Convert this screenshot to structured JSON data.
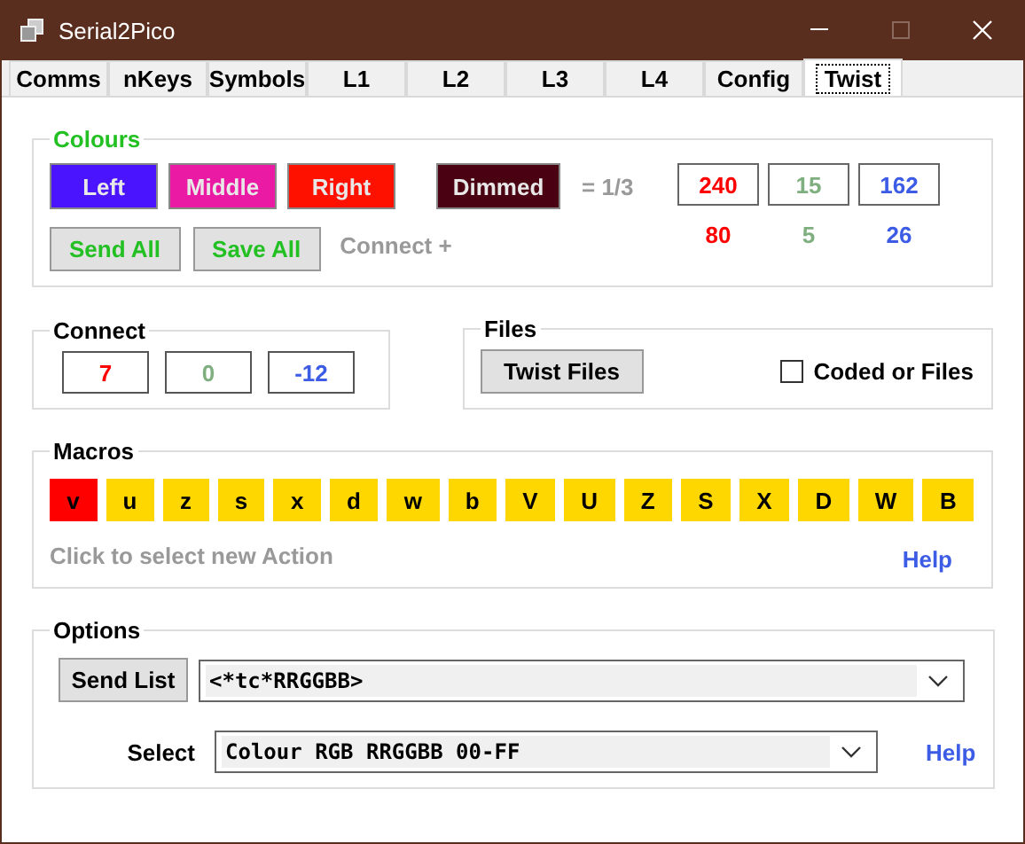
{
  "window": {
    "title": "Serial2Pico"
  },
  "tabs": [
    {
      "label": "Comms",
      "selected": false
    },
    {
      "label": "nKeys",
      "selected": false
    },
    {
      "label": "Symbols",
      "selected": false
    },
    {
      "label": "L1",
      "selected": false
    },
    {
      "label": "L2",
      "selected": false
    },
    {
      "label": "L3",
      "selected": false
    },
    {
      "label": "L4",
      "selected": false
    },
    {
      "label": "Config",
      "selected": false
    },
    {
      "label": "Twist",
      "selected": true
    }
  ],
  "colours": {
    "title": "Colours",
    "buttons": [
      {
        "label": "Left",
        "color": "#4b14ff"
      },
      {
        "label": "Middle",
        "color": "#ea1aa4"
      },
      {
        "label": "Right",
        "color": "#ff1100"
      }
    ],
    "dimmed": {
      "label": "Dimmed",
      "color": "#4a0212"
    },
    "ratio": "= 1/3",
    "actions": [
      "Send All",
      "Save All"
    ],
    "connect_label": "Connect +",
    "values": [
      {
        "value": "240",
        "scaled": "80",
        "color": "#ff0000"
      },
      {
        "value": "15",
        "scaled": "5",
        "color": "#7fae7f"
      },
      {
        "value": "162",
        "scaled": "26",
        "color": "#3c5ce6"
      }
    ]
  },
  "connect": {
    "title": "Connect",
    "values": [
      {
        "value": "7",
        "color": "#ff0000"
      },
      {
        "value": "0",
        "color": "#7fae7f"
      },
      {
        "value": "-12",
        "color": "#3c5ce6"
      }
    ]
  },
  "files": {
    "title": "Files",
    "button": "Twist Files",
    "checkbox": {
      "label": "Coded or Files",
      "checked": false
    }
  },
  "macros": {
    "title": "Macros",
    "keys": [
      {
        "label": "v",
        "selected": true
      },
      {
        "label": "u",
        "selected": false
      },
      {
        "label": "z",
        "selected": false
      },
      {
        "label": "s",
        "selected": false
      },
      {
        "label": "x",
        "selected": false
      },
      {
        "label": "d",
        "selected": false
      },
      {
        "label": "w",
        "selected": false
      },
      {
        "label": "b",
        "selected": false
      },
      {
        "label": "V",
        "selected": false
      },
      {
        "label": "U",
        "selected": false
      },
      {
        "label": "Z",
        "selected": false
      },
      {
        "label": "S",
        "selected": false
      },
      {
        "label": "X",
        "selected": false
      },
      {
        "label": "D",
        "selected": false
      },
      {
        "label": "W",
        "selected": false
      },
      {
        "label": "B",
        "selected": false
      }
    ],
    "hint": "Click to select new Action",
    "help": "Help"
  },
  "options": {
    "title": "Options",
    "send_button": "Send List",
    "send_value": "<*tc*RRGGBB>",
    "select_label": "Select",
    "select_value": "Colour RGB RRGGBB 00-FF",
    "help": "Help"
  }
}
